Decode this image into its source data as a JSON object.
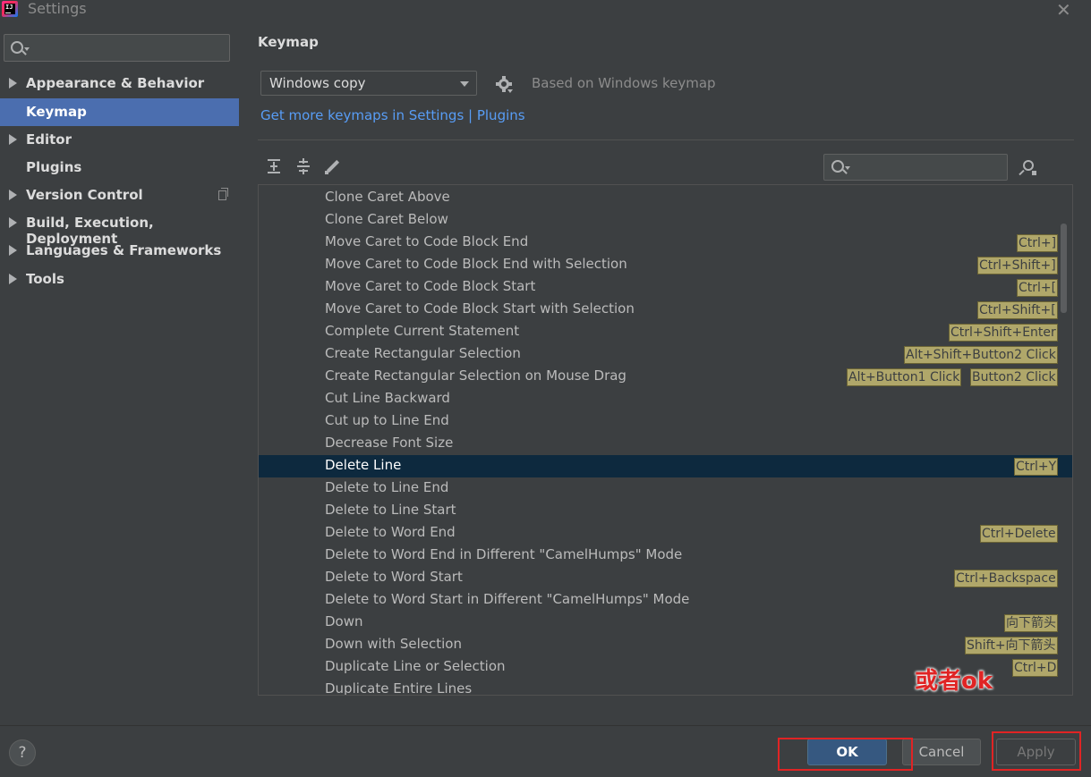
{
  "window": {
    "title": "Settings",
    "app_icon_text": "IJ",
    "close_glyph": "✕"
  },
  "sidebar": {
    "search": {
      "placeholder": "",
      "value": ""
    },
    "items": [
      {
        "label": "Appearance & Behavior",
        "expandable": true
      },
      {
        "label": "Keymap",
        "expandable": false,
        "selected": true
      },
      {
        "label": "Editor",
        "expandable": true
      },
      {
        "label": "Plugins",
        "expandable": false
      },
      {
        "label": "Version Control",
        "expandable": true
      },
      {
        "label": "Build, Execution, Deployment",
        "expandable": true
      },
      {
        "label": "Languages & Frameworks",
        "expandable": true
      },
      {
        "label": "Tools",
        "expandable": true
      }
    ]
  },
  "main": {
    "title": "Keymap",
    "keymap_select": {
      "value": "Windows copy"
    },
    "based_on": "Based on Windows keymap",
    "more_link": "Get more keymaps in Settings | Plugins",
    "toolbar": {
      "icons": [
        "expand-all-icon",
        "collapse-all-icon",
        "edit-pencil-icon"
      ]
    },
    "table_search": {
      "value": "",
      "placeholder": ""
    },
    "actions": [
      {
        "name": "Clone Caret Above",
        "shortcuts": []
      },
      {
        "name": "Clone Caret Below",
        "shortcuts": []
      },
      {
        "name": "Move Caret to Code Block End",
        "shortcuts": [
          "Ctrl+]"
        ]
      },
      {
        "name": "Move Caret to Code Block End with Selection",
        "shortcuts": [
          "Ctrl+Shift+]"
        ]
      },
      {
        "name": "Move Caret to Code Block Start",
        "shortcuts": [
          "Ctrl+["
        ]
      },
      {
        "name": "Move Caret to Code Block Start with Selection",
        "shortcuts": [
          "Ctrl+Shift+["
        ]
      },
      {
        "name": "Complete Current Statement",
        "shortcuts": [
          "Ctrl+Shift+Enter"
        ]
      },
      {
        "name": "Create Rectangular Selection",
        "shortcuts": [
          "Alt+Shift+Button2 Click"
        ]
      },
      {
        "name": "Create Rectangular Selection on Mouse Drag",
        "shortcuts": [
          "Alt+Button1 Click",
          "Button2 Click"
        ]
      },
      {
        "name": "Cut Line Backward",
        "shortcuts": []
      },
      {
        "name": "Cut up to Line End",
        "shortcuts": []
      },
      {
        "name": "Decrease Font Size",
        "shortcuts": []
      },
      {
        "name": "Delete Line",
        "shortcuts": [
          "Ctrl+Y"
        ],
        "selected": true
      },
      {
        "name": "Delete to Line End",
        "shortcuts": []
      },
      {
        "name": "Delete to Line Start",
        "shortcuts": []
      },
      {
        "name": "Delete to Word End",
        "shortcuts": [
          "Ctrl+Delete"
        ]
      },
      {
        "name": "Delete to Word End in Different \"CamelHumps\" Mode",
        "shortcuts": []
      },
      {
        "name": "Delete to Word Start",
        "shortcuts": [
          "Ctrl+Backspace"
        ]
      },
      {
        "name": "Delete to Word Start in Different \"CamelHumps\" Mode",
        "shortcuts": []
      },
      {
        "name": "Down",
        "shortcuts": [
          "向下箭头"
        ]
      },
      {
        "name": "Down with Selection",
        "shortcuts": [
          "Shift+向下箭头"
        ]
      },
      {
        "name": "Duplicate Line or Selection",
        "shortcuts": [
          "Ctrl+D"
        ]
      },
      {
        "name": "Duplicate Entire Lines",
        "shortcuts": []
      }
    ]
  },
  "annotation": {
    "text": "或者ok",
    "color": "#e02424"
  },
  "footer": {
    "help_label": "?",
    "ok_label": "OK",
    "cancel_label": "Cancel",
    "apply_label": "Apply"
  },
  "colors": {
    "background": "#3c3f41",
    "selection": "#4b6eaf",
    "row_selection": "#0d293e",
    "link": "#589df6",
    "shortcut_badge": "#b0a76a",
    "highlight_box": "#e02424"
  }
}
